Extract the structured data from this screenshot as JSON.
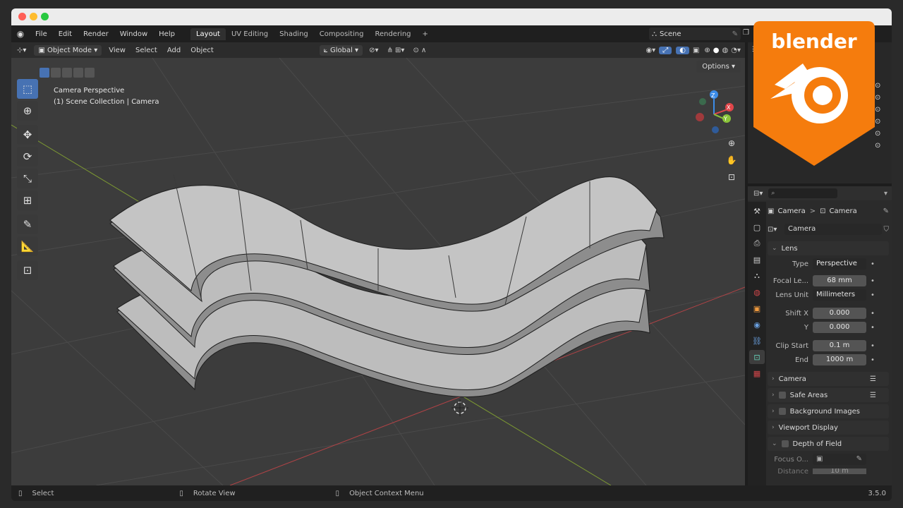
{
  "menu": {
    "items": [
      "File",
      "Edit",
      "Render",
      "Window",
      "Help"
    ],
    "workspaces": [
      "Layout",
      "UV Editing",
      "Shading",
      "Compositing",
      "Rendering"
    ],
    "add_workspace": "+",
    "scene_label": "Scene"
  },
  "header": {
    "mode": "Object Mode",
    "items": [
      "View",
      "Select",
      "Add",
      "Object"
    ],
    "orientation": "Global",
    "options_label": "Options"
  },
  "viewport": {
    "perspective": "Camera Perspective",
    "collection": "(1) Scene Collection | Camera"
  },
  "gizmo": {
    "x": "X",
    "y": "Y",
    "z": "Z"
  },
  "properties": {
    "breadcrumb_1": "Camera",
    "breadcrumb_sep": ">",
    "breadcrumb_2": "Camera",
    "data_name": "Camera",
    "lens_section": "Lens",
    "type_label": "Type",
    "type_value": "Perspective",
    "focal_label": "Focal Le...",
    "focal_value": "68 mm",
    "lens_unit_label": "Lens Unit",
    "lens_unit_value": "Millimeters",
    "shift_x_label": "Shift X",
    "shift_x_value": "0.000",
    "shift_y_label": "Y",
    "shift_y_value": "0.000",
    "clip_start_label": "Clip Start",
    "clip_start_value": "0.1 m",
    "clip_end_label": "End",
    "clip_end_value": "1000 m",
    "sections": [
      "Camera",
      "Safe Areas",
      "Background Images",
      "Viewport Display",
      "Depth of Field"
    ],
    "focus_label": "Focus O...",
    "distance_label": "Distance",
    "distance_value": "10 m"
  },
  "status": {
    "select": "Select",
    "rotate": "Rotate View",
    "context": "Object Context Menu",
    "version": "3.5.0"
  },
  "logo": {
    "text": "blender"
  },
  "colors": {
    "accent_blue": "#4772b3",
    "blender_orange": "#f57c0d",
    "active_tab_teal": "#66d1b8",
    "axis_x": "#e0464a",
    "axis_y": "#8bc43a",
    "axis_z": "#3c8ce8"
  }
}
